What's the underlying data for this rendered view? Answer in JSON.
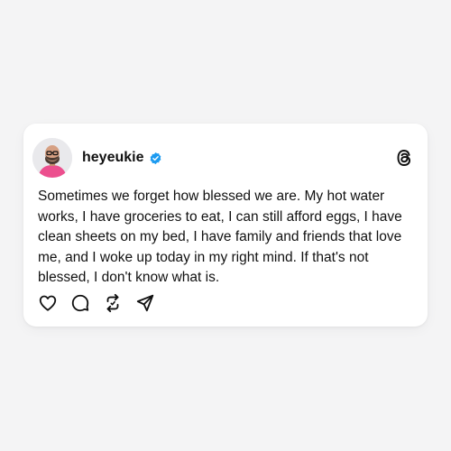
{
  "post": {
    "username": "heyeukie",
    "verified": true,
    "text": "Sometimes we forget how blessed we are. My hot water works, I have groceries to eat, I can still afford eggs, I have clean sheets on my bed, I have family and friends that love me, and I woke up today in my right mind. If that's not blessed, I don't know what is."
  },
  "icons": {
    "avatar": "profile-photo",
    "verified": "verified-badge-icon",
    "logo": "threads-logo-icon",
    "actions": [
      "heart-icon",
      "comment-icon",
      "repost-icon",
      "share-icon"
    ]
  },
  "colors": {
    "background": "#f4f4f5",
    "card": "#ffffff",
    "text": "#111111",
    "verified": "#1d9bf0",
    "avatar_shirt": "#ec4f8e"
  }
}
